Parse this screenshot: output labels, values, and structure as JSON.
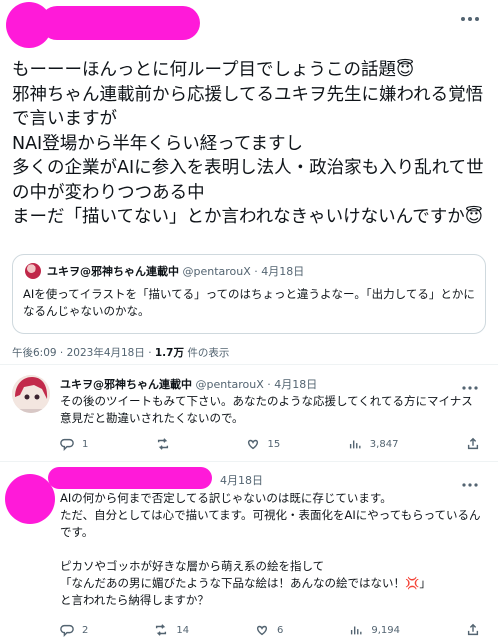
{
  "tweet": {
    "more_icon": "more-horizontal-icon",
    "text": "もーーーほんっとに何ループ目でしょうこの話題😇\n邪神ちゃん連載前から応援してるユキヲ先生に嫌われる覚悟で言いますが\nNAI登場から半年くらい経ってますし\n多くの企業がAIに参入を表明し法人・政治家も入り乱れて世の中が変わりつつある中\nまーだ「描いてない」とか言われなきゃいけないんですか😇",
    "quote": {
      "name": "ユキヲ@邪神ちゃん連載中",
      "handle": "@pentarouX",
      "date": "· 4月18日",
      "text": "AIを使ってイラストを「描いてる」ってのはちょっと違うよなー。「出力してる」とかになるんじゃないのかな。"
    },
    "meta_time": "午後6:09 · 2023年4月18日 · ",
    "meta_views": "1.7万",
    "meta_views_label": " 件の表示"
  },
  "reply1": {
    "name": "ユキヲ@邪神ちゃん連載中",
    "handle": "@pentarouX",
    "date": "· 4月18日",
    "text": "その後のツイートもみて下さい。あなたのような応援してくれてる方にマイナス意見だと勘違いされたくないので。",
    "replies": "1",
    "retweets": "",
    "likes": "15",
    "views": "3,847"
  },
  "reply2": {
    "date": "4月18日",
    "text": "AIの何から何まで否定してる訳じゃないのは既に存じています。\nただ、自分としては心で描いてます。可視化・表面化をAIにやってもらっているんです。\n\nピカソやゴッホが好きな層から萌え系の絵を指して\n「なんだあの男に媚びたような下品な絵は！あんなの絵ではない！💢」\nと言われたら納得しますか？",
    "replies": "2",
    "retweets": "14",
    "likes": "6",
    "views": "9,194"
  },
  "colors": {
    "redaction": "#ff1ad9",
    "text": "#0f1419",
    "muted": "#536471",
    "border": "#cfd9de"
  }
}
